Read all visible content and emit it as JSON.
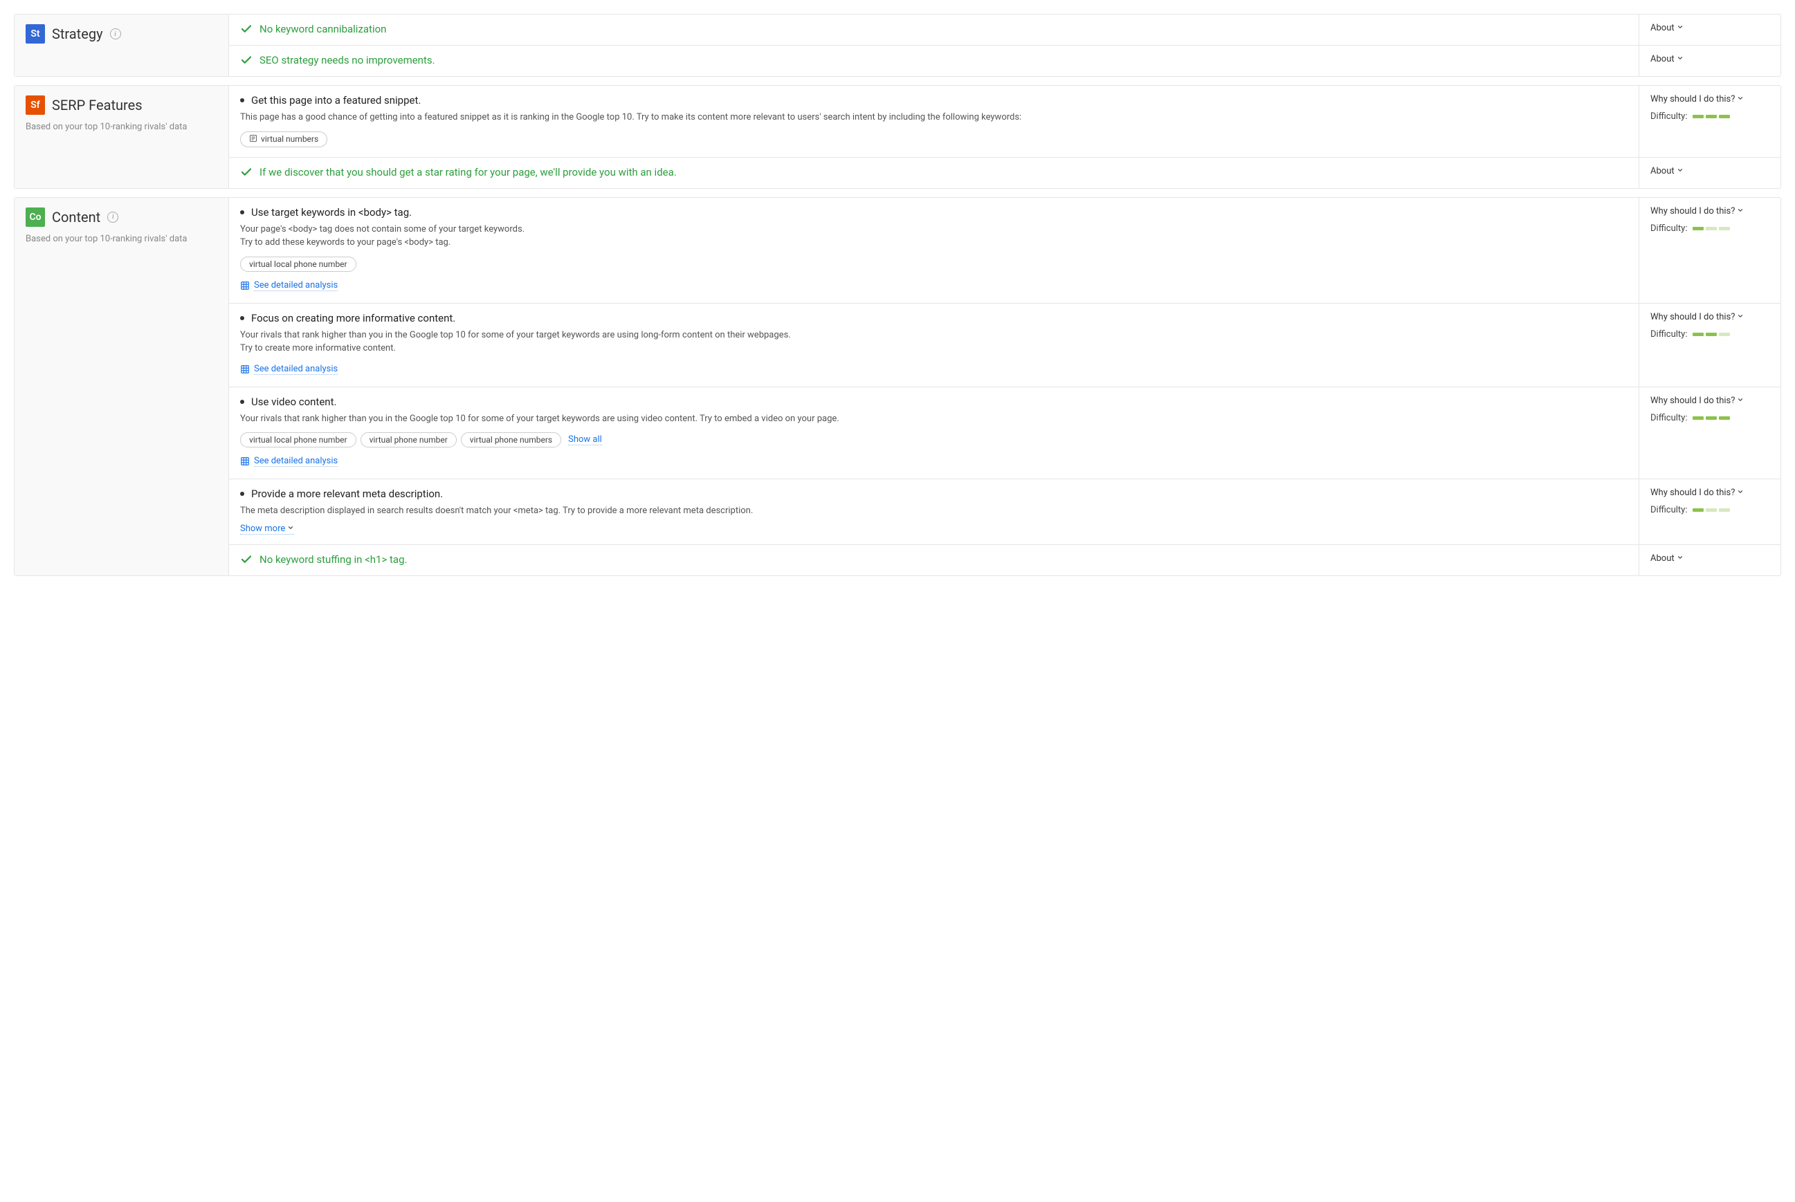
{
  "common": {
    "about_label": "About",
    "why_label": "Why should I do this?",
    "difficulty_label": "Difficulty:",
    "see_detailed": "See detailed analysis",
    "show_more": "Show more",
    "show_all": "Show all"
  },
  "sections": [
    {
      "badge": "St",
      "badge_color": "blue",
      "title": "Strategy",
      "has_info": true,
      "subtitle": "",
      "items": [
        {
          "type": "success",
          "heading": "No keyword cannibalization",
          "side_type": "about"
        },
        {
          "type": "success",
          "heading": "SEO strategy needs no improvements.",
          "side_type": "about"
        }
      ]
    },
    {
      "badge": "Sf",
      "badge_color": "orange",
      "title": "SERP Features",
      "has_info": false,
      "subtitle": "Based on your top 10-ranking rivals' data",
      "items": [
        {
          "type": "todo",
          "heading": "Get this page into a featured snippet.",
          "desc": "This page has a good chance of getting into a featured snippet as it is ranking in the Google top 10. Try to make its content more relevant to users' search intent by including the following keywords:",
          "tags": [
            "virtual numbers"
          ],
          "tags_icon": true,
          "side_type": "why",
          "difficulty": 3
        },
        {
          "type": "success",
          "heading": "If we discover that you should get a star rating for your page, we'll provide you with an idea.",
          "side_type": "about"
        }
      ]
    },
    {
      "badge": "Co",
      "badge_color": "green",
      "title": "Content",
      "has_info": true,
      "subtitle": "Based on your top 10-ranking rivals' data",
      "items": [
        {
          "type": "todo",
          "heading": "Use target keywords in <body> tag.",
          "desc": "Your page's <body> tag does not contain some of your target keywords.\nTry to add these keywords to your page's <body> tag.",
          "tags": [
            "virtual local phone number"
          ],
          "detailed_link": true,
          "side_type": "why",
          "difficulty": 1
        },
        {
          "type": "todo",
          "heading": "Focus on creating more informative content.",
          "desc": "Your rivals that rank higher than you in the Google top 10 for some of your target keywords are using long-form content on their webpages.\nTry to create more informative content.",
          "detailed_link": true,
          "side_type": "why",
          "difficulty": 2
        },
        {
          "type": "todo",
          "heading": "Use video content.",
          "desc": "Your rivals that rank higher than you in the Google top 10 for some of your target keywords are using video content. Try to embed a video on your page.",
          "tags": [
            "virtual local phone number",
            "virtual phone number",
            "virtual phone numbers"
          ],
          "show_all": true,
          "detailed_link": true,
          "side_type": "why",
          "difficulty": 3
        },
        {
          "type": "todo",
          "heading": "Provide a more relevant meta description.",
          "desc": "The meta description displayed in search results doesn't match your <meta> tag. Try to provide a more relevant meta description.",
          "show_more": true,
          "side_type": "why",
          "difficulty": 1
        },
        {
          "type": "success",
          "heading": "No keyword stuffing in <h1> tag.",
          "side_type": "about"
        }
      ]
    }
  ]
}
